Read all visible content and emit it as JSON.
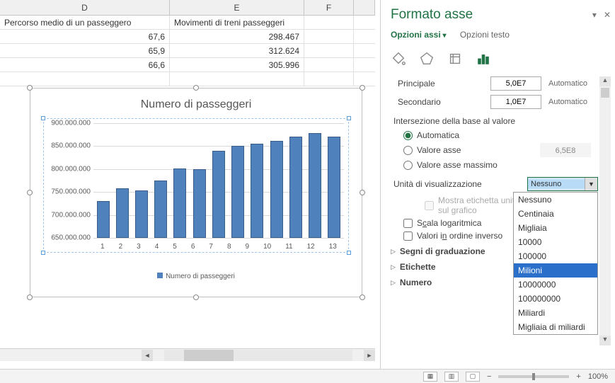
{
  "columns": {
    "d": "D",
    "e": "E",
    "f": "F"
  },
  "headers": {
    "d": "Percorso medio di un passeggero",
    "e": "Movimenti di treni passeggeri"
  },
  "rows": [
    {
      "d": "67,6",
      "e": "298.467"
    },
    {
      "d": "65,9",
      "e": "312.624"
    },
    {
      "d": "66,6",
      "e": "305.996"
    }
  ],
  "chart_data": {
    "type": "bar",
    "title": "Numero di passeggeri",
    "legend": "Numero di passeggeri",
    "categories": [
      "1",
      "2",
      "3",
      "4",
      "5",
      "6",
      "7",
      "8",
      "9",
      "10",
      "11",
      "12",
      "13"
    ],
    "values": [
      730000000,
      758000000,
      753000000,
      775000000,
      802000000,
      800000000,
      840000000,
      850000000,
      855000000,
      862000000,
      870000000,
      878000000,
      871000000
    ],
    "ylim": [
      650000000,
      900000000
    ],
    "yticks": [
      "650.000.000",
      "700.000.000",
      "750.000.000",
      "800.000.000",
      "850.000.000",
      "900.000.000"
    ]
  },
  "pane": {
    "title": "Formato asse",
    "tab_active": "Opzioni assi",
    "tab_other": "Opzioni testo",
    "principale_label": "Principale",
    "principale_value": "5,0E7",
    "secondario_label": "Secondario",
    "secondario_value": "1,0E7",
    "auto": "Automatico",
    "intersezione": "Intersezione della base al valore",
    "r_auto": "Automatica",
    "r_valore": "Valore asse",
    "r_valore_num": "6,5E8",
    "r_max": "Valore asse massimo",
    "unita": "Unità di visualizzazione",
    "unita_value": "Nessuno",
    "mostra_etichetta": "Mostra etichetta unità di visualizzazione sul grafico",
    "scala_log": "Scala logaritmica",
    "inverso": "Valori in ordine inverso",
    "seg": "Segni di graduazione",
    "etich": "Etichette",
    "numero": "Numero",
    "dd_options": [
      "Nessuno",
      "Centinaia",
      "Migliaia",
      "10000",
      "100000",
      "Milioni",
      "10000000",
      "100000000",
      "Miliardi",
      "Migliaia di miliardi"
    ],
    "dd_highlight": "Milioni"
  },
  "status": {
    "zoom": "100%"
  }
}
